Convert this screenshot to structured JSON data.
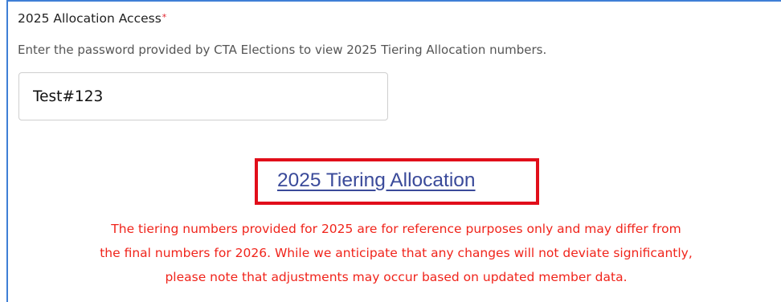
{
  "form": {
    "label": "2025 Allocation Access",
    "required_marker": "*",
    "help_text": "Enter the password provided by CTA Elections to view 2025 Tiering Allocation numbers.",
    "password_value": "Test#123",
    "link_label": "2025 Tiering Allocation",
    "disclaimer_lines": [
      "The tiering numbers provided for 2025 are for reference purposes only and may differ from",
      "the final numbers for 2026. While we anticipate that any changes will not deviate significantly,",
      "please note that adjustments may occur based on updated member data."
    ]
  },
  "colors": {
    "frame_border": "#3f7fd6",
    "required": "#e0202a",
    "highlight": "#e10e1a",
    "link": "#3a4a9a",
    "disclaimer": "#f0241b"
  }
}
